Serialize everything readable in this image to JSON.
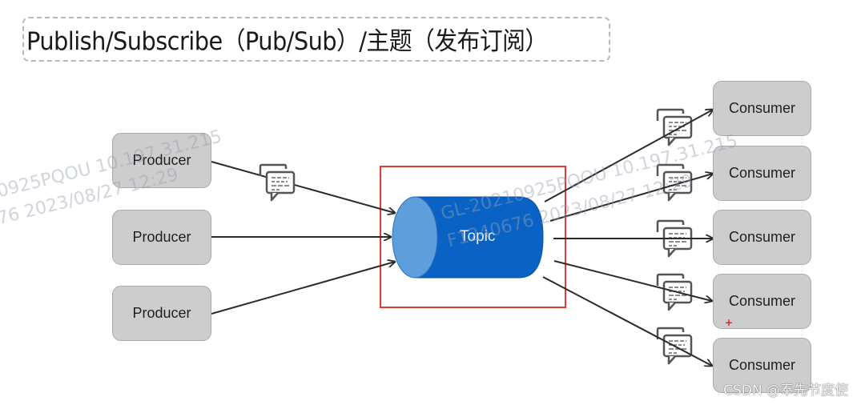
{
  "title": "Publish/Subscribe（Pub/Sub）/主题（发布订阅）",
  "producers": [
    {
      "label": "Producer"
    },
    {
      "label": "Producer"
    },
    {
      "label": "Producer"
    }
  ],
  "topic": {
    "label": "Topic",
    "color": "#0a63c4",
    "cap_color": "#5d9fdc",
    "highlight_box_color": "#e53935"
  },
  "consumers": [
    {
      "label": "Consumer"
    },
    {
      "label": "Consumer"
    },
    {
      "label": "Consumer"
    },
    {
      "label": "Consumer"
    },
    {
      "label": "Consumer"
    }
  ],
  "message_icon": "chat-message-icon",
  "watermarks": [
    "0925PQOU  10.197.31.215",
    "76 2023/08/27 12:29",
    "GL-20210925PQOU  10.197.31.215",
    "F1240676 2023/08/27 12:29"
  ],
  "footer_credit": "CSDN @奉先节度使"
}
